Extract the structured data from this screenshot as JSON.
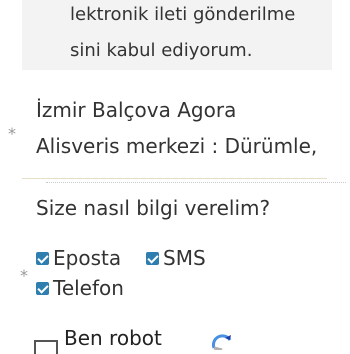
{
  "consent": {
    "line1": "lektronik ileti gönderilme",
    "line2": "sini kabul ediyorum."
  },
  "location": {
    "line1": "İzmir Balçova Agora",
    "line2": "Alisveris merkezi : Dürümle,"
  },
  "contact_question": "Size nasıl bilgi verelim?",
  "options": {
    "email": "Eposta",
    "sms": "SMS",
    "phone": "Telefon"
  },
  "captcha": {
    "label": "Ben robot"
  },
  "required_mark": "*",
  "colors": {
    "checkbox": "#2e7fb0",
    "consent_bg": "#f3f3f3"
  },
  "icons": {
    "captcha": "recaptcha-logo-icon"
  }
}
